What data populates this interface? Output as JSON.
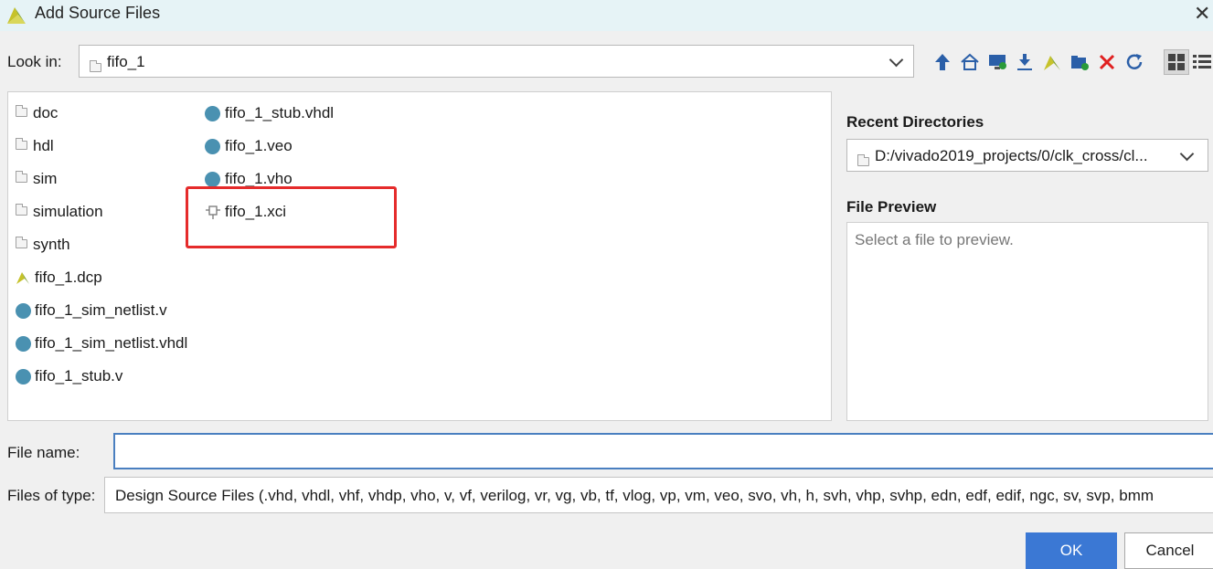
{
  "window": {
    "title": "Add Source Files",
    "close_glyph": "✕"
  },
  "lookin": {
    "label": "Look in:",
    "value": "fifo_1"
  },
  "toolbar": {
    "icons": [
      "up-folder-icon",
      "home-icon",
      "desktop-icon",
      "download-icon",
      "vivado-icon",
      "new-folder-icon",
      "delete-icon",
      "refresh-icon",
      "grid-view-icon",
      "list-view-icon"
    ]
  },
  "files": {
    "col1": [
      {
        "name": "doc",
        "icon": "folder-icon"
      },
      {
        "name": "hdl",
        "icon": "folder-icon"
      },
      {
        "name": "sim",
        "icon": "folder-icon"
      },
      {
        "name": "simulation",
        "icon": "folder-icon"
      },
      {
        "name": "synth",
        "icon": "folder-icon"
      },
      {
        "name": "fifo_1.dcp",
        "icon": "vivado-icon"
      },
      {
        "name": "fifo_1_sim_netlist.v",
        "icon": "file-dot-icon"
      },
      {
        "name": "fifo_1_sim_netlist.vhdl",
        "icon": "file-dot-icon"
      },
      {
        "name": "fifo_1_stub.v",
        "icon": "file-dot-icon"
      }
    ],
    "col2": [
      {
        "name": "fifo_1_stub.vhdl",
        "icon": "file-dot-icon"
      },
      {
        "name": "fifo_1.veo",
        "icon": "file-dot-icon"
      },
      {
        "name": "fifo_1.vho",
        "icon": "file-dot-icon"
      },
      {
        "name": "fifo_1.xci",
        "icon": "ip-core-icon"
      }
    ]
  },
  "recent": {
    "label": "Recent Directories",
    "value": "D:/vivado2019_projects/0/clk_cross/cl..."
  },
  "preview": {
    "label": "File Preview",
    "placeholder": "Select a file to preview."
  },
  "filename": {
    "label": "File name:",
    "value": ""
  },
  "filetype": {
    "label": "Files of type:",
    "value": "Design Source Files (.vhd, vhdl, vhf, vhdp, vho, v, vf, verilog, vr, vg, vb, tf, vlog, vp, vm, veo, svo, vh, h, svh, vhp, svhp, edn, edf, edif, ngc, sv, svp, bmm"
  },
  "buttons": {
    "ok": "OK",
    "cancel": "Cancel"
  },
  "colors": {
    "accent": "#3b78d4",
    "highlight": "#e52b2b",
    "file_dot": "#4a91b1"
  }
}
